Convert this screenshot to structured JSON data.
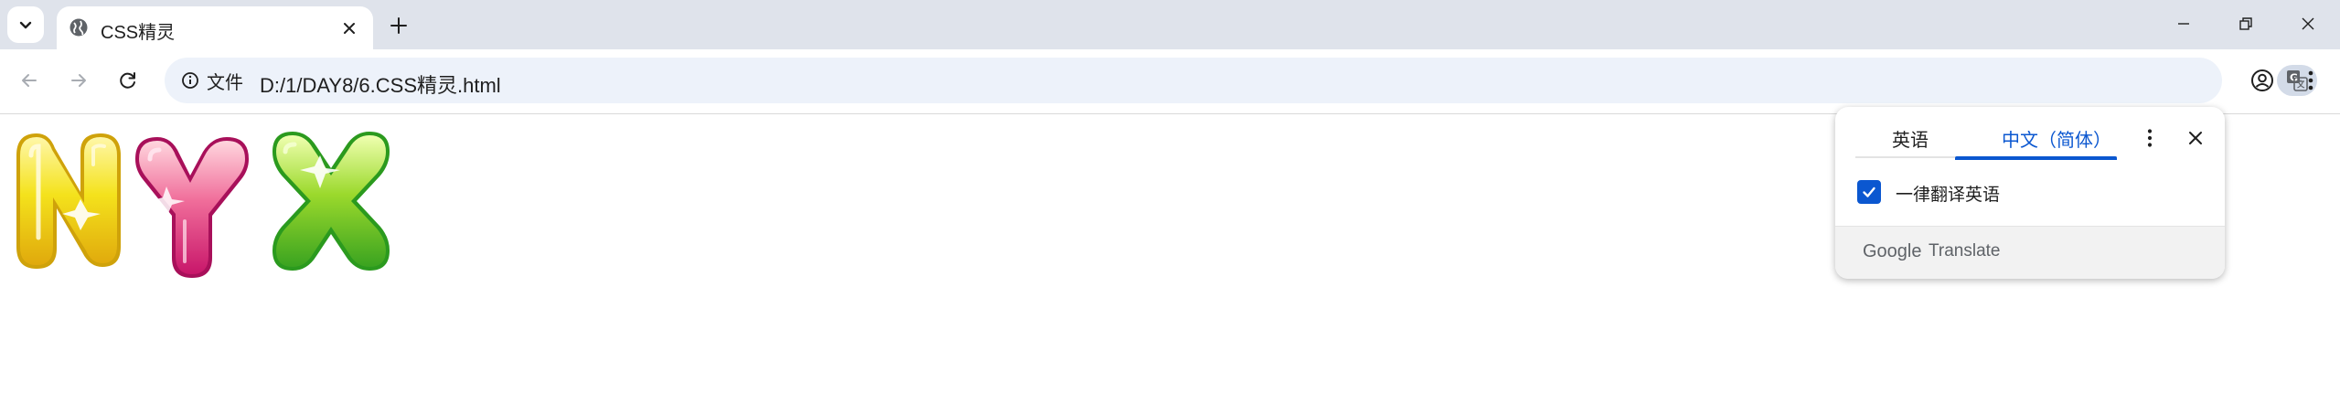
{
  "colors": {
    "tabstrip_bg": "#dfe3eb",
    "omnibox_bg": "#edf2fa",
    "accent_blue": "#0b57d0",
    "text": "#1f1f1f"
  },
  "tab": {
    "title": "CSS精灵",
    "favicon": "globe-icon",
    "close_icon": "close-icon"
  },
  "toolbar": {
    "site_info_label": "文件",
    "url": "D:/1/DAY8/6.CSS精灵.html",
    "icons": [
      "back-arrow-icon",
      "forward-arrow-icon",
      "reload-icon",
      "info-icon",
      "translate-icon",
      "star-icon",
      "profile-icon",
      "menu-kebab-icon"
    ]
  },
  "window_controls": [
    "minimize-icon",
    "restore-icon",
    "close-window-icon"
  ],
  "content": {
    "sprites": [
      {
        "name": "letter-N-yellow",
        "color": "#f2d81a"
      },
      {
        "name": "letter-Y-pink",
        "color": "#e4287a"
      },
      {
        "name": "letter-X-green",
        "color": "#8dd22a"
      }
    ]
  },
  "translate_popup": {
    "source_lang": "英语",
    "target_lang": "中文（简体）",
    "always_translate_label": "一律翻译英语",
    "always_translate_checked": true,
    "brand_google": "Google",
    "brand_translate": "Translate"
  }
}
